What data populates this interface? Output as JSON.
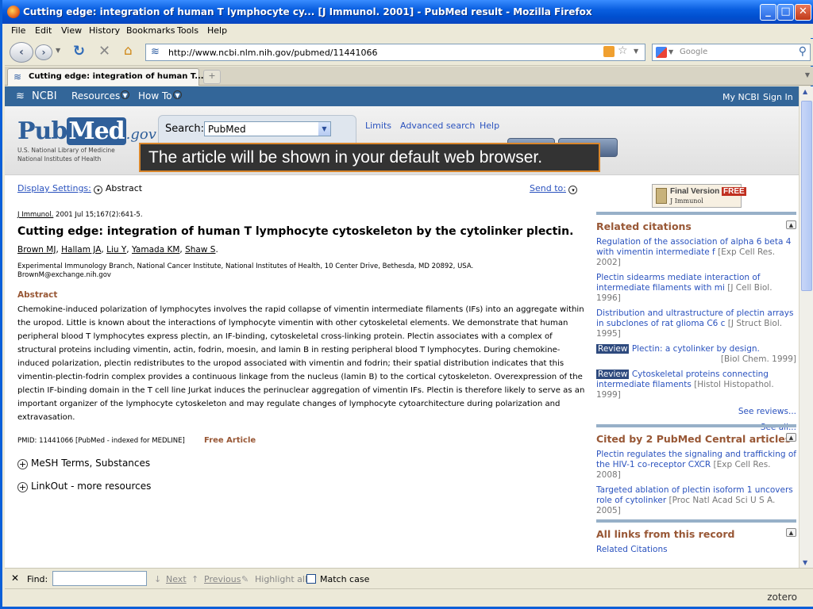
{
  "window": {
    "title": "Cutting edge: integration of human T lymphocyte cy... [J Immunol. 2001] - PubMed result - Mozilla Firefox",
    "controls": {
      "minimize": "_",
      "maximize": "□",
      "close": "✕"
    }
  },
  "menu": [
    "File",
    "Edit",
    "View",
    "History",
    "Bookmarks",
    "Tools",
    "Help"
  ],
  "nav": {
    "url": "http://www.ncbi.nlm.nih.gov/pubmed/11441066",
    "search_placeholder": "Google"
  },
  "tabs": [
    {
      "label": "Cutting edge: integration of human T..."
    }
  ],
  "ncbi": {
    "logo": "NCBI",
    "resources": "Resources",
    "howto": "How To",
    "mynbci": "My NCBI",
    "signin": "Sign In"
  },
  "pubmed": {
    "logo_pub": "Pub",
    "logo_med": "Med",
    "logo_gov": ".gov",
    "sub1": "U.S. National Library of Medicine",
    "sub2": "National Institutes of Health",
    "search_label": "Search:",
    "db_selected": "PubMed",
    "links": {
      "limits": "Limits",
      "advanced": "Advanced search",
      "help": "Help"
    }
  },
  "tooltip": "The article will be shown in your default web browser.",
  "article": {
    "display_settings": "Display Settings:",
    "format": "Abstract",
    "send_to": "Send to:",
    "journal": "J Immunol.",
    "citation": " 2001 Jul 15;167(2):641-5.",
    "title": "Cutting edge: integration of human T lymphocyte cytoskeleton by the cytolinker plectin.",
    "authors": [
      "Brown MJ",
      "Hallam JA",
      "Liu Y",
      "Yamada KM",
      "Shaw S"
    ],
    "affiliation": "Experimental Immunology Branch, National Cancer Institute, National Institutes of Health, 10 Center Drive, Bethesda, MD 20892, USA.",
    "email": "BrownM@exchange.nih.gov",
    "abstract_heading": "Abstract",
    "abstract": "Chemokine-induced polarization of lymphocytes involves the rapid collapse of vimentin intermediate filaments (IFs) into an aggregate within the uropod. Little is known about the interactions of lymphocyte vimentin with other cytoskeletal elements. We demonstrate that human peripheral blood T lymphocytes express plectin, an IF-binding, cytoskeletal cross-linking protein. Plectin associates with a complex of structural proteins including vimentin, actin, fodrin, moesin, and lamin B in resting peripheral blood T lymphocytes. During chemokine-induced polarization, plectin redistributes to the uropod associated with vimentin and fodrin; their spatial distribution indicates that this vimentin-plectin-fodrin complex provides a continuous linkage from the nucleus (lamin B) to the cortical cytoskeleton. Overexpression of the plectin IF-binding domain in the T cell line Jurkat induces the perinuclear aggregation of vimentin IFs. Plectin is therefore likely to serve as an important organizer of the lymphocyte cytoskeleton and may regulate changes of lymphocyte cytoarchitecture during polarization and extravasation.",
    "pmid": "PMID: 11441066 [PubMed - indexed for MEDLINE]",
    "free_article": "Free Article",
    "mesh": "MeSH Terms, Substances",
    "linkout": "LinkOut - more resources"
  },
  "sidebar": {
    "final_version": "Final Version",
    "free": "FREE",
    "journal_badge": "J Immunol",
    "related": {
      "heading": "Related citations",
      "items": [
        {
          "title": "Regulation of the association of alpha 6 beta 4 with vimentin intermediate f",
          "source": "[Exp Cell Res. 2002]"
        },
        {
          "title": "Plectin sidearms mediate interaction of intermediate filaments with mi",
          "source": "[J Cell Biol. 1996]"
        },
        {
          "title": "Distribution and ultrastructure of plectin arrays in subclones of rat glioma C6 c",
          "source": "[J Struct Biol. 1995]"
        },
        {
          "badge": "Review",
          "title": "Plectin: a cytolinker by design.",
          "source": "[Biol Chem. 1999]"
        },
        {
          "badge": "Review",
          "title": "Cytoskeletal proteins connecting intermediate filaments",
          "source": "[Histol Histopathol. 1999]"
        }
      ],
      "see_reviews": "See reviews...",
      "see_all": "See all..."
    },
    "cited": {
      "heading": "Cited by 2 PubMed Central articles",
      "items": [
        {
          "title": "Plectin regulates the signaling and trafficking of the HIV-1 co-receptor CXCR",
          "source": "[Exp Cell Res. 2008]"
        },
        {
          "title": "Targeted ablation of plectin isoform 1 uncovers role of cytolinker",
          "source": "[Proc Natl Acad Sci U S A. 2005]"
        }
      ]
    },
    "links": {
      "heading": "All links from this record",
      "first": "Related Citations"
    }
  },
  "findbar": {
    "close": "✕",
    "label": "Find:",
    "next": "Next",
    "previous": "Previous",
    "highlight": "Highlight all",
    "matchcase": "Match case"
  },
  "status": {
    "zotero": "zotero"
  }
}
